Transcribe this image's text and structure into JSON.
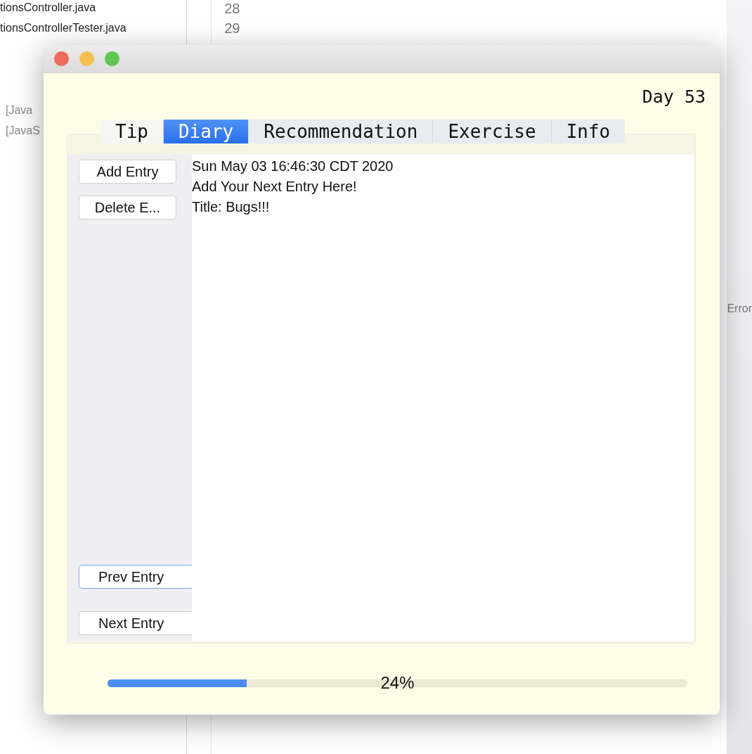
{
  "background": {
    "files": [
      "tionsController.java",
      "tionsControllerTester.java"
    ],
    "line_numbers": [
      "28",
      "29"
    ],
    "console_items": [
      "[Java",
      "[JavaS"
    ],
    "side_tab": "Error"
  },
  "window": {
    "day": "Day 53",
    "tabs": [
      {
        "label": "Tip",
        "selected": false
      },
      {
        "label": "Diary",
        "selected": true
      },
      {
        "label": "Recommendation",
        "selected": false
      },
      {
        "label": "Exercise",
        "selected": false
      },
      {
        "label": "Info",
        "selected": false
      }
    ],
    "top_buttons": [
      {
        "label": "Add Entry",
        "focused": false
      },
      {
        "label": "Delete E...",
        "focused": false
      }
    ],
    "bottom_buttons": [
      {
        "label": "Prev Entry",
        "focused": true
      },
      {
        "label": "Next Entry",
        "focused": false
      }
    ],
    "entry_lines": [
      "Sun May 03 16:46:30 CDT 2020",
      "Add Your Next Entry Here!",
      "Title: Bugs!!!"
    ],
    "progress": {
      "level": 0.24,
      "reading": "24%"
    }
  }
}
